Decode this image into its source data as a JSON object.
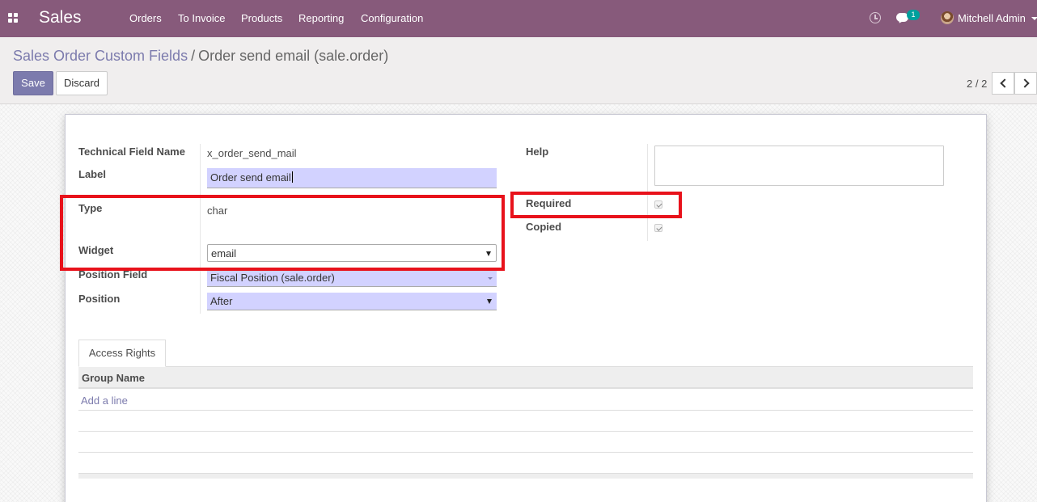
{
  "navbar": {
    "app_name": "Sales",
    "menu": [
      "Orders",
      "To Invoice",
      "Products",
      "Reporting",
      "Configuration"
    ],
    "chat_count": "1",
    "user_name": "Mitchell Admin"
  },
  "breadcrumb": {
    "parent": "Sales Order Custom Fields",
    "separator": "/",
    "current": "Order send email (sale.order)"
  },
  "buttons": {
    "save": "Save",
    "discard": "Discard"
  },
  "pager": {
    "value": "2 / 2"
  },
  "form": {
    "technical_field_name": {
      "label": "Technical Field Name",
      "value": "x_order_send_mail"
    },
    "label_field": {
      "label": "Label",
      "value": "Order send email"
    },
    "type": {
      "label": "Type",
      "value": "char"
    },
    "widget": {
      "label": "Widget",
      "value": "email"
    },
    "position_field": {
      "label": "Position Field",
      "value": "Fiscal Position (sale.order)"
    },
    "position": {
      "label": "Position",
      "value": "After"
    },
    "help": {
      "label": "Help",
      "value": ""
    },
    "required": {
      "label": "Required",
      "checked": true
    },
    "copied": {
      "label": "Copied",
      "checked": true
    }
  },
  "notebook": {
    "tab_label": "Access Rights",
    "column_header": "Group Name",
    "add_line": "Add a line"
  },
  "colors": {
    "navbar": "#875a7b",
    "primary": "#7c7bad",
    "highlight": "#e8121b",
    "required_input": "#d2d2ff",
    "chat_badge": "#00a09d"
  }
}
